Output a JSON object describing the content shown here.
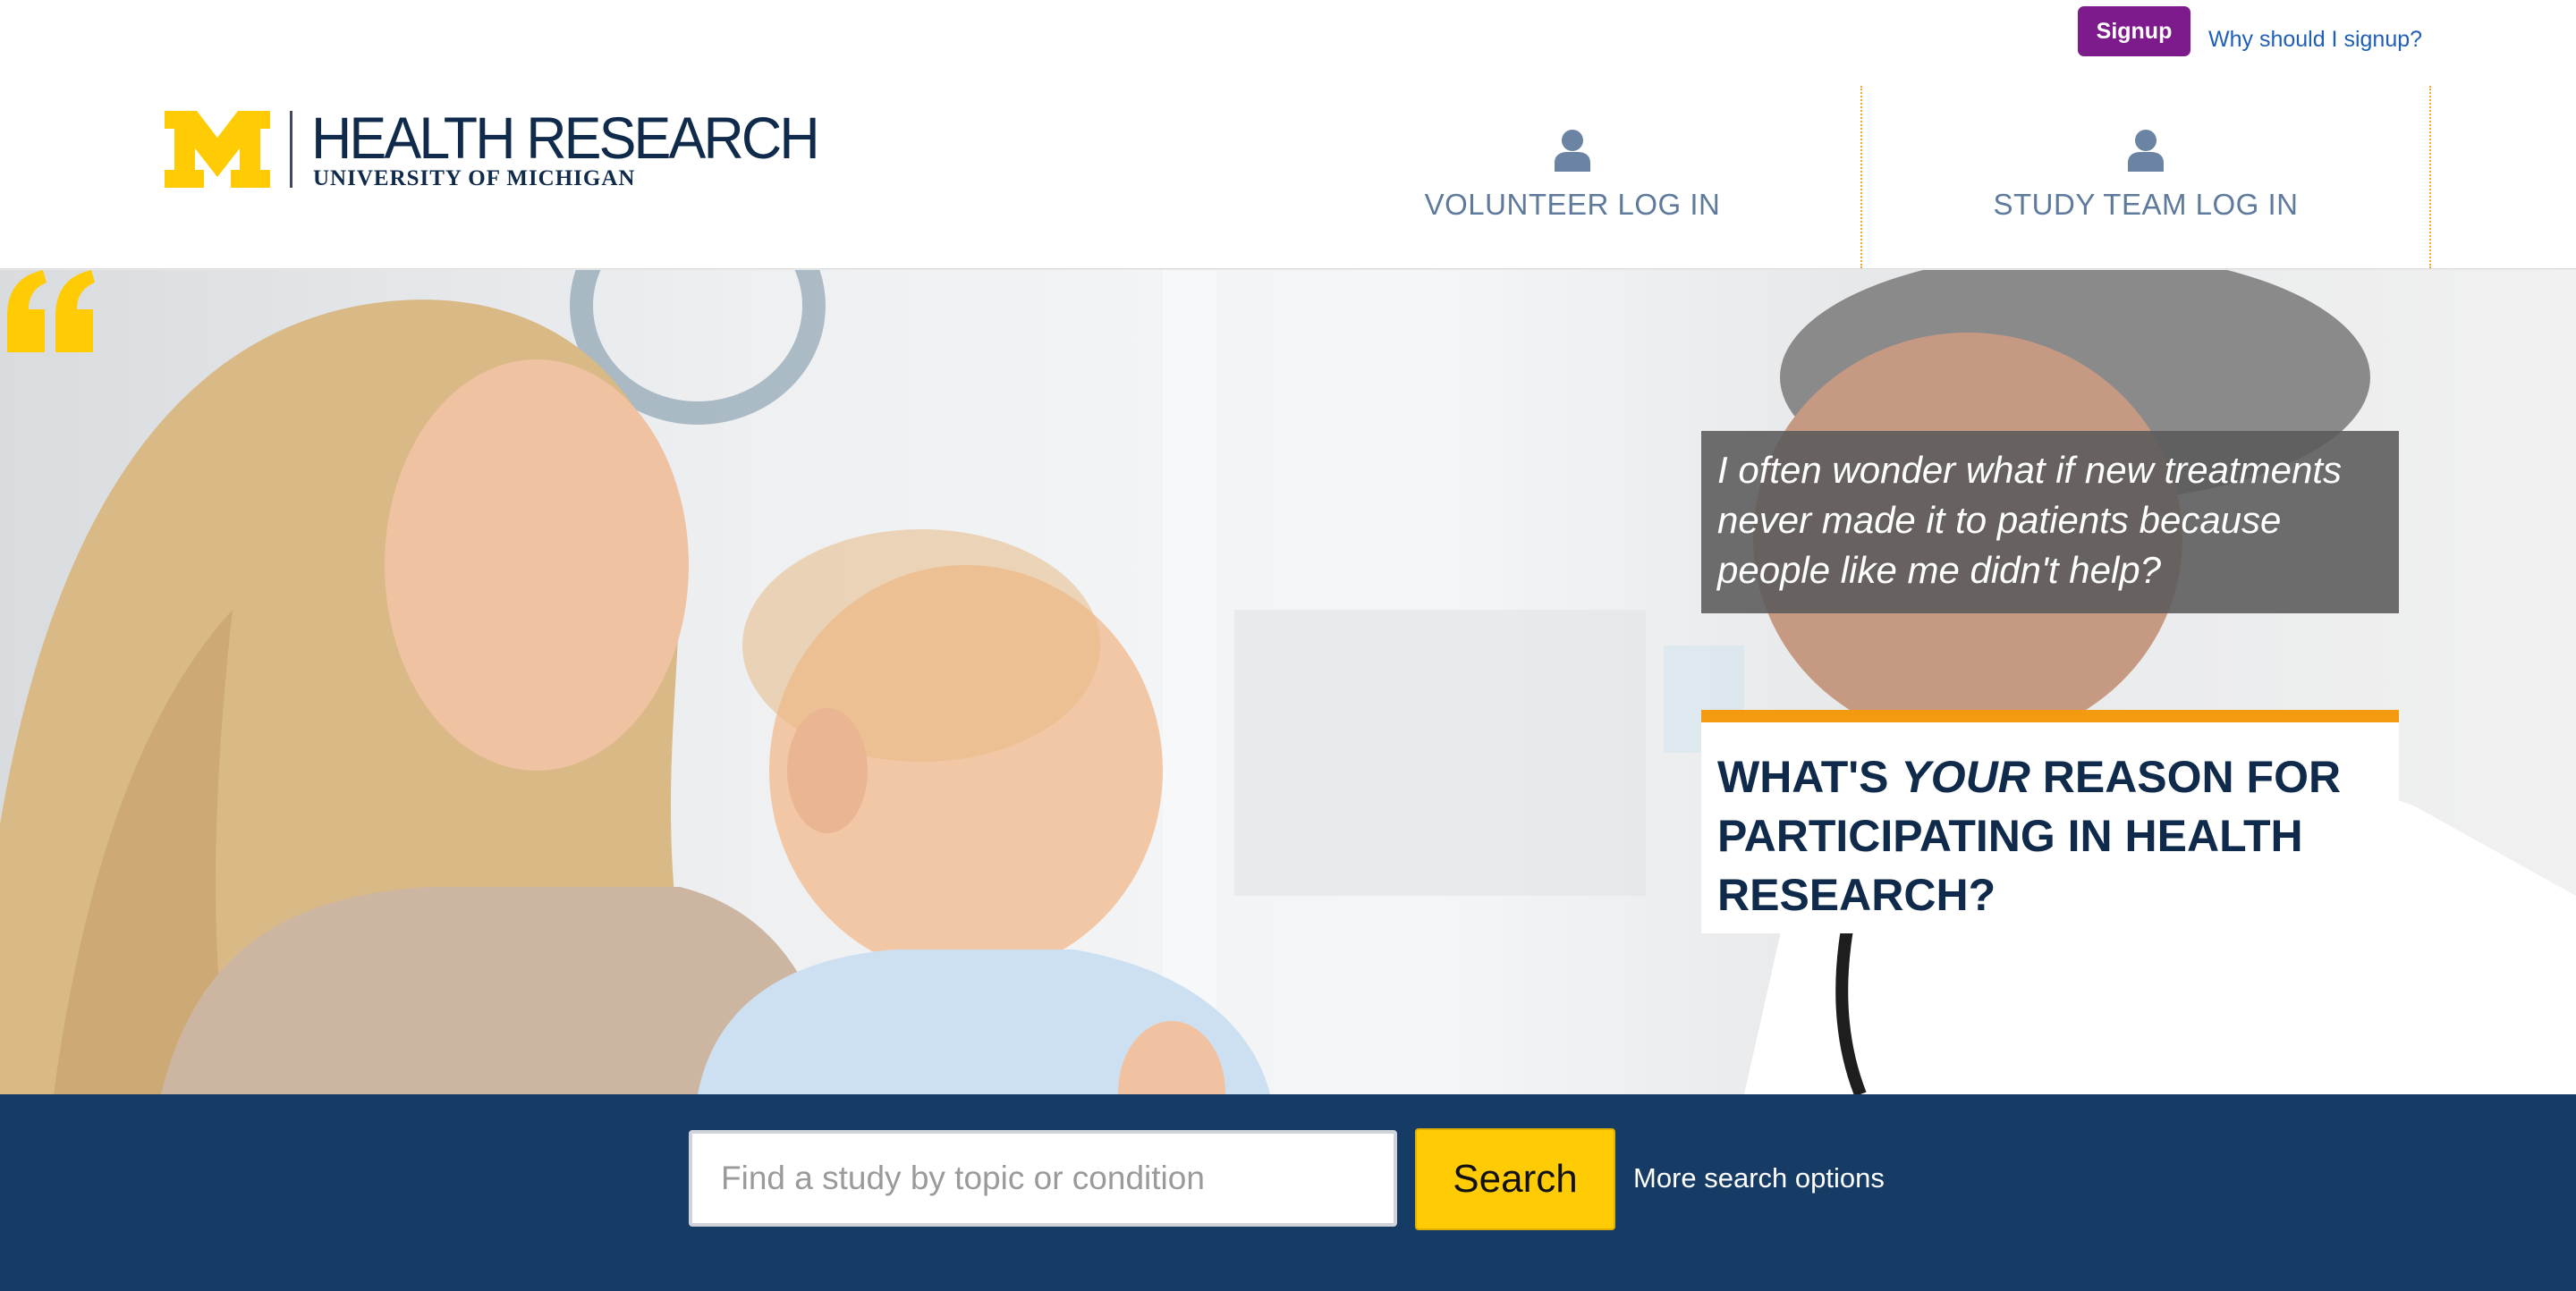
{
  "header": {
    "signup_label": "Signup",
    "why_signup_label": "Why should I signup?",
    "logo": {
      "title": "HEALTH RESEARCH",
      "subtitle": "UNIVERSITY OF MICHIGAN"
    },
    "volunteer_login_label": "VOLUNTEER LOG IN",
    "study_team_login_label": "STUDY TEAM LOG IN"
  },
  "hero": {
    "quote": "I often wonder what if new treatments never made it to patients because people like me didn't help?",
    "reason_pre": "WHAT'S ",
    "reason_em": "YOUR",
    "reason_post": " REASON FOR PARTICIPATING IN HEALTH RESEARCH?"
  },
  "search": {
    "placeholder": "Find a study by topic or condition",
    "value": "",
    "button_label": "Search",
    "more_options_label": "More search options"
  },
  "colors": {
    "brand_navy": "#163c66",
    "maize": "#ffcb05",
    "signup_purple": "#7d1a8c",
    "accent_orange": "#f39a10"
  }
}
